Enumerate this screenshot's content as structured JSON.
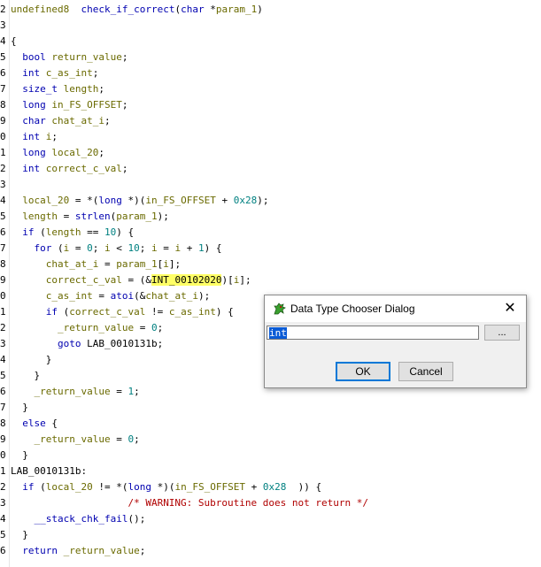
{
  "code": {
    "line_numbers": [
      "2",
      "3",
      "4",
      "5",
      "6",
      "7",
      "8",
      "9",
      "0",
      "1",
      "2",
      "3",
      "4",
      "5",
      "6",
      "7",
      "8",
      "9",
      "0",
      "1",
      "2",
      "3",
      "4",
      "5",
      "6",
      "7",
      "8",
      "9",
      "0",
      "1",
      "2",
      "3",
      "4",
      "5",
      "6"
    ],
    "lines": [
      {
        "parts": [
          [
            "var",
            "undefined8"
          ],
          [
            "",
            "  "
          ],
          [
            "fn",
            "check_if_correct"
          ],
          [
            "",
            "("
          ],
          [
            "kw",
            "char"
          ],
          [
            "",
            " *"
          ],
          [
            "var",
            "param_1"
          ],
          [
            "",
            ")"
          ]
        ]
      },
      {
        "parts": []
      },
      {
        "parts": [
          [
            "",
            "{"
          ]
        ]
      },
      {
        "parts": [
          [
            "",
            "  "
          ],
          [
            "kw",
            "bool"
          ],
          [
            "",
            " "
          ],
          [
            "var",
            "return_value"
          ],
          [
            "",
            ";"
          ]
        ]
      },
      {
        "parts": [
          [
            "",
            "  "
          ],
          [
            "kw",
            "int"
          ],
          [
            "",
            " "
          ],
          [
            "var",
            "c_as_int"
          ],
          [
            "",
            ";"
          ]
        ]
      },
      {
        "parts": [
          [
            "",
            "  "
          ],
          [
            "kw",
            "size_t"
          ],
          [
            "",
            " "
          ],
          [
            "var",
            "length"
          ],
          [
            "",
            ";"
          ]
        ]
      },
      {
        "parts": [
          [
            "",
            "  "
          ],
          [
            "kw",
            "long"
          ],
          [
            "",
            " "
          ],
          [
            "var",
            "in_FS_OFFSET"
          ],
          [
            "",
            ";"
          ]
        ]
      },
      {
        "parts": [
          [
            "",
            "  "
          ],
          [
            "kw",
            "char"
          ],
          [
            "",
            " "
          ],
          [
            "var",
            "chat_at_i"
          ],
          [
            "",
            ";"
          ]
        ]
      },
      {
        "parts": [
          [
            "",
            "  "
          ],
          [
            "kw",
            "int"
          ],
          [
            "",
            " "
          ],
          [
            "var",
            "i"
          ],
          [
            "",
            ";"
          ]
        ]
      },
      {
        "parts": [
          [
            "",
            "  "
          ],
          [
            "kw",
            "long"
          ],
          [
            "",
            " "
          ],
          [
            "var",
            "local_20"
          ],
          [
            "",
            ";"
          ]
        ]
      },
      {
        "parts": [
          [
            "",
            "  "
          ],
          [
            "kw",
            "int"
          ],
          [
            "",
            " "
          ],
          [
            "var",
            "correct_c_val"
          ],
          [
            "",
            ";"
          ]
        ]
      },
      {
        "parts": []
      },
      {
        "parts": [
          [
            "",
            "  "
          ],
          [
            "var",
            "local_20"
          ],
          [
            "",
            " = *("
          ],
          [
            "kw",
            "long"
          ],
          [
            "",
            " *)("
          ],
          [
            "var",
            "in_FS_OFFSET"
          ],
          [
            "",
            " + "
          ],
          [
            "num",
            "0x28"
          ],
          [
            "",
            ");"
          ]
        ]
      },
      {
        "parts": [
          [
            "",
            "  "
          ],
          [
            "var",
            "length"
          ],
          [
            "",
            " = "
          ],
          [
            "fn",
            "strlen"
          ],
          [
            "",
            "("
          ],
          [
            "var",
            "param_1"
          ],
          [
            "",
            ");"
          ]
        ]
      },
      {
        "parts": [
          [
            "",
            "  "
          ],
          [
            "kw",
            "if"
          ],
          [
            "",
            " ("
          ],
          [
            "var",
            "length"
          ],
          [
            "",
            " == "
          ],
          [
            "num",
            "10"
          ],
          [
            "",
            ") {"
          ]
        ]
      },
      {
        "parts": [
          [
            "",
            "    "
          ],
          [
            "kw",
            "for"
          ],
          [
            "",
            " ("
          ],
          [
            "var",
            "i"
          ],
          [
            "",
            " = "
          ],
          [
            "num",
            "0"
          ],
          [
            "",
            "; "
          ],
          [
            "var",
            "i"
          ],
          [
            "",
            " < "
          ],
          [
            "num",
            "10"
          ],
          [
            "",
            "; "
          ],
          [
            "var",
            "i"
          ],
          [
            "",
            " = "
          ],
          [
            "var",
            "i"
          ],
          [
            "",
            " + "
          ],
          [
            "num",
            "1"
          ],
          [
            "",
            ") {"
          ]
        ]
      },
      {
        "parts": [
          [
            "",
            "      "
          ],
          [
            "var",
            "chat_at_i"
          ],
          [
            "",
            " = "
          ],
          [
            "var",
            "param_1"
          ],
          [
            "",
            "["
          ],
          [
            "var",
            "i"
          ],
          [
            "",
            "];"
          ]
        ]
      },
      {
        "parts": [
          [
            "",
            "      "
          ],
          [
            "var",
            "correct_c_val"
          ],
          [
            "",
            " = (&"
          ],
          [
            "hl",
            "INT_00102020"
          ],
          [
            "",
            ")["
          ],
          [
            "var",
            "i"
          ],
          [
            "",
            "];"
          ]
        ]
      },
      {
        "parts": [
          [
            "",
            "      "
          ],
          [
            "var",
            "c_as_int"
          ],
          [
            "",
            " = "
          ],
          [
            "fn",
            "atoi"
          ],
          [
            "",
            "(&"
          ],
          [
            "var",
            "chat_at_i"
          ],
          [
            "",
            ");"
          ]
        ]
      },
      {
        "parts": [
          [
            "",
            "      "
          ],
          [
            "kw",
            "if"
          ],
          [
            "",
            " ("
          ],
          [
            "var",
            "correct_c_val"
          ],
          [
            "",
            " != "
          ],
          [
            "var",
            "c_as_int"
          ],
          [
            "",
            ") {"
          ]
        ]
      },
      {
        "parts": [
          [
            "",
            "        "
          ],
          [
            "var",
            "_return_value"
          ],
          [
            "",
            " = "
          ],
          [
            "num",
            "0"
          ],
          [
            "",
            ";"
          ]
        ]
      },
      {
        "parts": [
          [
            "",
            "        "
          ],
          [
            "kw",
            "goto"
          ],
          [
            "",
            " LAB_0010131b;"
          ]
        ]
      },
      {
        "parts": [
          [
            "",
            "      }"
          ]
        ]
      },
      {
        "parts": [
          [
            "",
            "    }"
          ]
        ]
      },
      {
        "parts": [
          [
            "",
            "    "
          ],
          [
            "var",
            "_return_value"
          ],
          [
            "",
            " = "
          ],
          [
            "num",
            "1"
          ],
          [
            "",
            ";"
          ]
        ]
      },
      {
        "parts": [
          [
            "",
            "  }"
          ]
        ]
      },
      {
        "parts": [
          [
            "",
            "  "
          ],
          [
            "kw",
            "else"
          ],
          [
            "",
            " {"
          ]
        ]
      },
      {
        "parts": [
          [
            "",
            "    "
          ],
          [
            "var",
            "_return_value"
          ],
          [
            "",
            " = "
          ],
          [
            "num",
            "0"
          ],
          [
            "",
            ";"
          ]
        ]
      },
      {
        "parts": [
          [
            "",
            "  }"
          ]
        ]
      },
      {
        "parts": [
          [
            "",
            "LAB_0010131b:"
          ]
        ]
      },
      {
        "parts": [
          [
            "",
            "  "
          ],
          [
            "kw",
            "if"
          ],
          [
            "",
            " ("
          ],
          [
            "var",
            "local_20"
          ],
          [
            "",
            " != *("
          ],
          [
            "kw",
            "long"
          ],
          [
            "",
            " *)("
          ],
          [
            "var",
            "in_FS_OFFSET"
          ],
          [
            "",
            " + "
          ],
          [
            "num",
            "0x28"
          ],
          [
            "",
            "  )) {"
          ]
        ]
      },
      {
        "parts": [
          [
            "",
            "                    "
          ],
          [
            "cmt",
            "/* WARNING: Subroutine does not return */"
          ]
        ]
      },
      {
        "parts": [
          [
            "",
            "    "
          ],
          [
            "fn",
            "__stack_chk_fail"
          ],
          [
            "",
            "();"
          ]
        ]
      },
      {
        "parts": [
          [
            "",
            "  }"
          ]
        ]
      },
      {
        "parts": [
          [
            "",
            "  "
          ],
          [
            "kw",
            "return"
          ],
          [
            "",
            " "
          ],
          [
            "var",
            "_return_value"
          ],
          [
            "",
            ";"
          ]
        ]
      }
    ]
  },
  "dialog": {
    "title": "Data Type Chooser Dialog",
    "close_glyph": "✕",
    "input_value": "int",
    "browse_label": "...",
    "ok_label": "OK",
    "cancel_label": "Cancel",
    "icon": "dragon-icon"
  },
  "colors": {
    "keyword": "#0000b0",
    "number": "#008080",
    "comment": "#b00000",
    "variable": "#6a6a00",
    "highlight": "#ffff66",
    "selection": "#0a5bd6"
  }
}
